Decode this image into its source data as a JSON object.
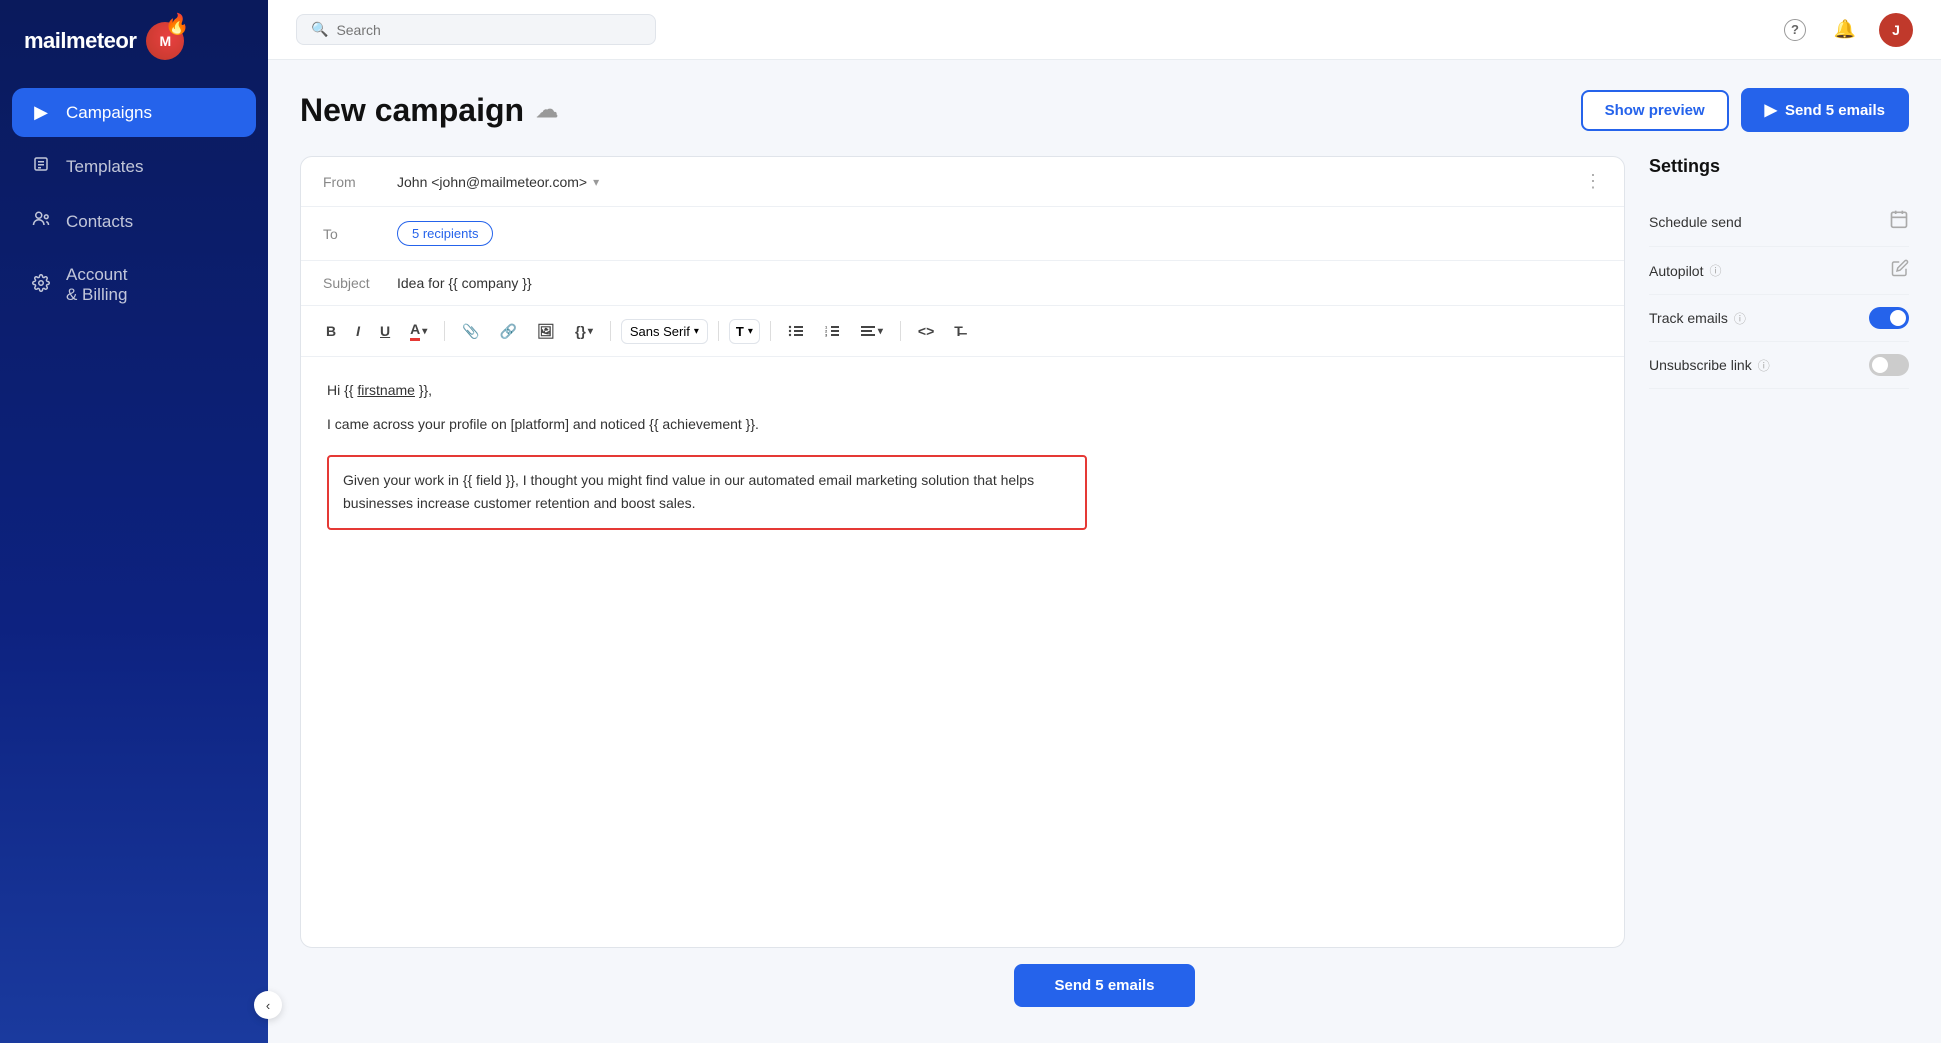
{
  "sidebar": {
    "logo_text": "mailmeteor",
    "logo_initial": "M",
    "nav_items": [
      {
        "id": "campaigns",
        "label": "Campaigns",
        "icon": "▶",
        "active": true
      },
      {
        "id": "templates",
        "label": "Templates",
        "icon": "📄",
        "active": false
      },
      {
        "id": "contacts",
        "label": "Contacts",
        "icon": "👥",
        "active": false
      },
      {
        "id": "account",
        "label": "Account\n& Billing",
        "icon": "⚙",
        "active": false
      }
    ],
    "collapse_icon": "‹"
  },
  "topbar": {
    "search_placeholder": "Search",
    "help_icon": "?",
    "bell_icon": "🔔",
    "avatar_text": "J"
  },
  "campaign": {
    "title": "New campaign",
    "cloud_icon": "☁",
    "show_preview_label": "Show preview",
    "send_button_label": "Send 5 emails",
    "send_count": 5
  },
  "composer": {
    "from_label": "From",
    "from_value": "John <john@mailmeteor.com>",
    "to_label": "To",
    "recipients_label": "5 recipients",
    "subject_label": "Subject",
    "subject_value": "Idea for {{ company }}",
    "body_lines": [
      "Hi {{ firstname }},",
      "",
      "I came across your profile on [platform] and noticed {{ achievement }}.",
      "",
      "Given your work in {{ field }}, I thought you might find value in our automated email marketing solution that helps businesses increase customer retention and boost sales."
    ],
    "highlighted_text": "Given your work in {{ field }}, I thought you might find value in our automated email marketing solution that helps businesses increase customer retention and boost sales."
  },
  "toolbar": {
    "bold": "B",
    "italic": "I",
    "underline": "U",
    "text_color": "A",
    "attach": "📎",
    "link": "🔗",
    "image": "🖼",
    "code_vars": "{}",
    "font_family": "Sans Serif",
    "font_size": "T↕",
    "bullet_list": "≡",
    "numbered_list": "☰",
    "align": "≡",
    "code": "<>",
    "clear": "T̶"
  },
  "settings": {
    "title": "Settings",
    "items": [
      {
        "id": "schedule_send",
        "label": "Schedule send",
        "type": "calendar"
      },
      {
        "id": "autopilot",
        "label": "Autopilot",
        "type": "edit",
        "has_info": true
      },
      {
        "id": "track_emails",
        "label": "Track emails",
        "type": "toggle",
        "value": true,
        "has_info": true
      },
      {
        "id": "unsubscribe_link",
        "label": "Unsubscribe link",
        "type": "toggle",
        "value": false,
        "has_info": true
      }
    ]
  },
  "bottom": {
    "send_button_label": "Send 5 emails"
  }
}
